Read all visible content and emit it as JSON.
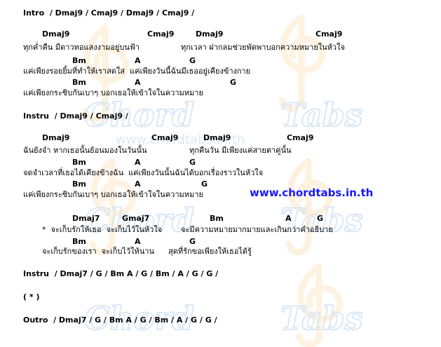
{
  "watermark": {
    "words": [
      "chord",
      "tabs"
    ],
    "site": "www.chordtabs.in.th",
    "colors": {
      "light_blue": "#d7e6f4",
      "light_orange": "#fde7c8"
    }
  },
  "url": "www.chordtabs.in.th",
  "url_color": "#1a1aff",
  "lines": {
    "l01": "Intro  / Dmaj9 / Cmaj9 / Dmaj9 / Cmaj9 /",
    "l02": "Dmaj9",
    "l03": "Cmaj9",
    "l04": "Dmaj9",
    "l05": "Cmaj9",
    "l06": "ทุกค่ำคืน มีดาวทอแสงงามอยู่บนฟ้า",
    "l07": "ทุกเวลา ฝากลมช่วยพัดพาบอกความหมายในหัวใจ",
    "l08": "Bm",
    "l09": "A",
    "l10": "G",
    "l11": "แค่เพียงรอยยิ้มที่ทำให้เราสดใส  แค่เพียงวันนี้ฉันมีเธออยู่เคียงข้างกาย",
    "l12": "Bm",
    "l13": "A",
    "l14": "G",
    "l15": "แค่เพียงกระซิบกันเบาๆ บอกเธอให้เข้าใจในความหมาย",
    "l16": "Instru  / Dmaj9 / Cmaj9 /",
    "l17": "Dmaj9",
    "l18": "Cmaj9",
    "l19": "Dmaj9",
    "l20": "Cmaj9",
    "l21": "ฉันยังจำ หากเธอนั้นย้อนมองในวันนั้น",
    "l22": "ทุกคืนวัน มีเพียงแค่สายตาคู่นั้น",
    "l23": "Bm",
    "l24": "A",
    "l25": "G",
    "l26": "จดจำเวลาที่เธอได้เคียงข้างฉัน  แค่เพียงวันนั้นฉันได้บอกเรื่องราวในหัวใจ",
    "l27": "Bm",
    "l28": "A",
    "l29": "G",
    "l30": "แค่เพียงกระซิบกันเบาๆ บอกเธอให้เข้าใจในความหมาย",
    "l31": "Dmaj7",
    "l32": "Gmaj7",
    "l33": "Bm",
    "l34": "A",
    "l35": "G",
    "l36": "*  จะเก็บรักให้เธอ  จะเก็บไว้ในหัวใจ",
    "l37": "จะมีความหมายมากมายและเกินกว่าคำอธิบาย",
    "l38": "Bm",
    "l39": "A",
    "l40": "G",
    "l41": "จะเก็บรักของเรา  จะเก็บไว้ให้นาน",
    "l42": "สุดที่รักขอเพียงให้เธอได้รู้",
    "l43": "Instru  / Dmaj7 / G / Bm A / G / Bm / A / G / G /",
    "l44": "( * )",
    "l45": "Outro  / Dmaj7 / G / Bm A / G / Bm / A / G / G /"
  }
}
